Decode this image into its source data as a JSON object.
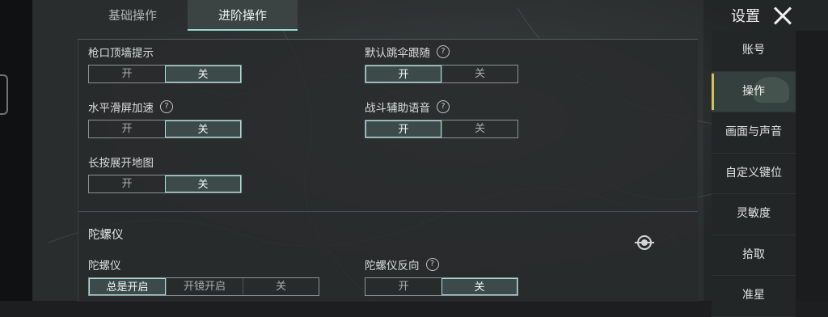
{
  "top_tabs": [
    {
      "label": "基础操作",
      "active": false
    },
    {
      "label": "进阶操作",
      "active": true
    }
  ],
  "header": {
    "title": "设置",
    "close_icon": "close-icon"
  },
  "settings": {
    "muzzle_wall_hint": {
      "label": "枪口顶墙提示",
      "options": [
        "开",
        "关"
      ],
      "selected": "关"
    },
    "default_parachute_follow": {
      "label": "默认跳伞跟随",
      "has_help": true,
      "options": [
        "开",
        "关"
      ],
      "selected": "开"
    },
    "horizontal_swipe_accel": {
      "label": "水平滑屏加速",
      "has_help": true,
      "options": [
        "开",
        "关"
      ],
      "selected": "关"
    },
    "combat_voice_assist": {
      "label": "战斗辅助语音",
      "has_help": true,
      "options": [
        "开",
        "关"
      ],
      "selected": "开"
    },
    "long_press_map": {
      "label": "长按展开地图",
      "options": [
        "开",
        "关"
      ],
      "selected": "关"
    }
  },
  "gyro_section": {
    "title": "陀螺仪",
    "gyroscope": {
      "label": "陀螺仪",
      "options": [
        "总是开启",
        "开镜开启",
        "关"
      ],
      "selected": "总是开启"
    },
    "gyro_reverse": {
      "label": "陀螺仪反向",
      "has_help": true,
      "options": [
        "开",
        "关"
      ],
      "selected": "关"
    }
  },
  "help_glyph": "?",
  "sidebar": {
    "items": [
      {
        "label": "账号",
        "active": false
      },
      {
        "label": "操作",
        "active": true
      },
      {
        "label": "画面与声音",
        "active": false
      },
      {
        "label": "自定义键位",
        "active": false
      },
      {
        "label": "灵敏度",
        "active": false
      },
      {
        "label": "拾取",
        "active": false
      },
      {
        "label": "准星",
        "active": false
      }
    ]
  },
  "colors": {
    "accent": "#a9e0d7",
    "active_marker": "#d6c05a",
    "background": "#2b2e2f"
  }
}
